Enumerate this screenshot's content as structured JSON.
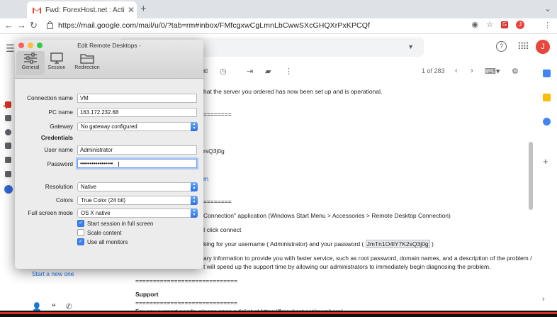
{
  "browser": {
    "tab_title": "Fwd: ForexHost.net : Activated",
    "tab_close": "✕",
    "new_tab": "+",
    "url": "https://mail.google.com/mail/u/0/?tab=rm#inbox/FMfcgxwCgLmnLbCwwSXcGHQXrPxKPCQf",
    "account_initial": "J",
    "ext_badge": "G"
  },
  "gmail": {
    "pager": "1 of 283",
    "avatar_initial": "J",
    "start_link": "Start a new one",
    "lines": {
      "l1": "hat the server you ordered has now been set up and is operational.",
      "l2": "========",
      "l3": "rsQ3j0g",
      "l4": "m",
      "l5": "========",
      "l6": "Connection\" application (Windows Start Menu > Accessories > Remote Desktop Connection)",
      "l7": "I click connect",
      "l8a": "king for your username ( Administrator) and your password ( ",
      "l8b": "JmTn1O4lY7K2sQ3j0g",
      "l8c": " )",
      "l9": "ary information to provide you with faster service, such as root password, domain names, and a description of the problem /",
      "l10": "t will speed up the support time by allowing our administrators to immediately begin diagnosing the problem.",
      "l11": "=============================",
      "l12": "Support",
      "l13": "=============================",
      "l14": "For any support needs, please open a ticket at https://forexhost.net/members/"
    }
  },
  "dialog": {
    "title": "Edit Remote Desktops -",
    "toolbar": {
      "general": "General",
      "session": "Session",
      "redirection": "Redirection"
    },
    "labels": {
      "connection_name": "Connection name",
      "pc_name": "PC name",
      "gateway": "Gateway",
      "credentials": "Credentials",
      "user_name": "User name",
      "password": "Password",
      "resolution": "Resolution",
      "colors": "Colors",
      "full_screen_mode": "Full screen mode"
    },
    "values": {
      "connection_name": "VM",
      "pc_name": "163.172.232.68",
      "gateway": "No gateway configured",
      "user_name": "Administrator",
      "password": "•••••••••••••••••",
      "resolution": "Native",
      "colors": "True Color (24 bit)",
      "full_screen_mode": "OS X native"
    },
    "checkboxes": {
      "start_full": "Start session in full screen",
      "scale": "Scale content",
      "all_monitors": "Use all monitors"
    }
  },
  "colors": {
    "accent": "#3b82f0",
    "gmail_red": "#ea4335"
  }
}
